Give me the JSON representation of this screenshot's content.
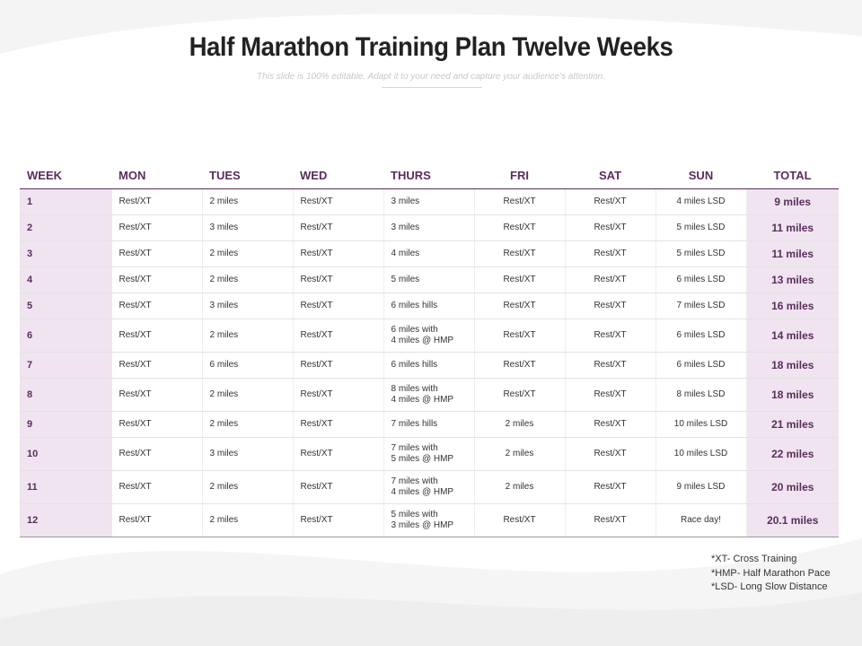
{
  "slide": {
    "title": "Half Marathon Training Plan Twelve Weeks",
    "subtitle": "This slide is 100% editable. Adapt it to your need and capture your audience’s attention."
  },
  "table": {
    "columns": [
      "WEEK",
      "MON",
      "TUES",
      "WED",
      "THURS",
      "FRI",
      "SAT",
      "SUN",
      "TOTAL"
    ],
    "rows": [
      {
        "week": "1",
        "mon": "Rest/XT",
        "tues": "2 miles",
        "wed": "Rest/XT",
        "thurs": [
          "3 miles"
        ],
        "fri": "Rest/XT",
        "sat": "Rest/XT",
        "sun": "4 miles  LSD",
        "total": "9 miles"
      },
      {
        "week": "2",
        "mon": "Rest/XT",
        "tues": "3 miles",
        "wed": "Rest/XT",
        "thurs": [
          "3 miles"
        ],
        "fri": "Rest/XT",
        "sat": "Rest/XT",
        "sun": "5 miles  LSD",
        "total": "11 miles"
      },
      {
        "week": "3",
        "mon": "Rest/XT",
        "tues": "2 miles",
        "wed": "Rest/XT",
        "thurs": [
          "4 miles"
        ],
        "fri": "Rest/XT",
        "sat": "Rest/XT",
        "sun": "5 miles  LSD",
        "total": "11 miles"
      },
      {
        "week": "4",
        "mon": "Rest/XT",
        "tues": "2 miles",
        "wed": "Rest/XT",
        "thurs": [
          "5 miles"
        ],
        "fri": "Rest/XT",
        "sat": "Rest/XT",
        "sun": "6 miles  LSD",
        "total": "13 miles"
      },
      {
        "week": "5",
        "mon": "Rest/XT",
        "tues": "3 miles",
        "wed": "Rest/XT",
        "thurs": [
          "6 miles  hills"
        ],
        "fri": "Rest/XT",
        "sat": "Rest/XT",
        "sun": "7 miles  LSD",
        "total": "16 miles"
      },
      {
        "week": "6",
        "mon": "Rest/XT",
        "tues": "2 miles",
        "wed": "Rest/XT",
        "thurs": [
          "6 miles  with",
          "4 miles  @ HMP"
        ],
        "fri": "Rest/XT",
        "sat": "Rest/XT",
        "sun": "6 miles  LSD",
        "total": "14 miles"
      },
      {
        "week": "7",
        "mon": "Rest/XT",
        "tues": "6 miles",
        "wed": "Rest/XT",
        "thurs": [
          "6 miles  hills"
        ],
        "fri": "Rest/XT",
        "sat": "Rest/XT",
        "sun": "6 miles  LSD",
        "total": "18 miles"
      },
      {
        "week": "8",
        "mon": "Rest/XT",
        "tues": "2 miles",
        "wed": "Rest/XT",
        "thurs": [
          "8 miles  with",
          "4 miles  @ HMP"
        ],
        "fri": "Rest/XT",
        "sat": "Rest/XT",
        "sun": "8 miles  LSD",
        "total": "18 miles"
      },
      {
        "week": "9",
        "mon": "Rest/XT",
        "tues": "2 miles",
        "wed": "Rest/XT",
        "thurs": [
          "7 miles  hills"
        ],
        "fri": "2 miles",
        "sat": "Rest/XT",
        "sun": "10 miles  LSD",
        "total": "21 miles"
      },
      {
        "week": "10",
        "mon": "Rest/XT",
        "tues": "3 miles",
        "wed": "Rest/XT",
        "thurs": [
          "7 miles  with",
          "5 miles  @ HMP"
        ],
        "fri": "2 miles",
        "sat": "Rest/XT",
        "sun": "10 miles  LSD",
        "total": "22 miles"
      },
      {
        "week": "11",
        "mon": "Rest/XT",
        "tues": "2 miles",
        "wed": "Rest/XT",
        "thurs": [
          "7 miles  with",
          "4 miles  @ HMP"
        ],
        "fri": "2 miles",
        "sat": "Rest/XT",
        "sun": "9 miles  LSD",
        "total": "20 miles"
      },
      {
        "week": "12",
        "mon": "Rest/XT",
        "tues": "2 miles",
        "wed": "Rest/XT",
        "thurs": [
          "5 miles  with",
          "3 miles  @ HMP"
        ],
        "fri": "Rest/XT",
        "sat": "Rest/XT",
        "sun": "Race day!",
        "total": "20.1 miles"
      }
    ]
  },
  "notes": [
    "*XT-  Cross  Training",
    "*HMP-  Half Marathon Pace",
    "*LSD-  Long Slow Distance"
  ],
  "colors": {
    "accent": "#5a2d5c",
    "highlight": "#efe4ef"
  }
}
